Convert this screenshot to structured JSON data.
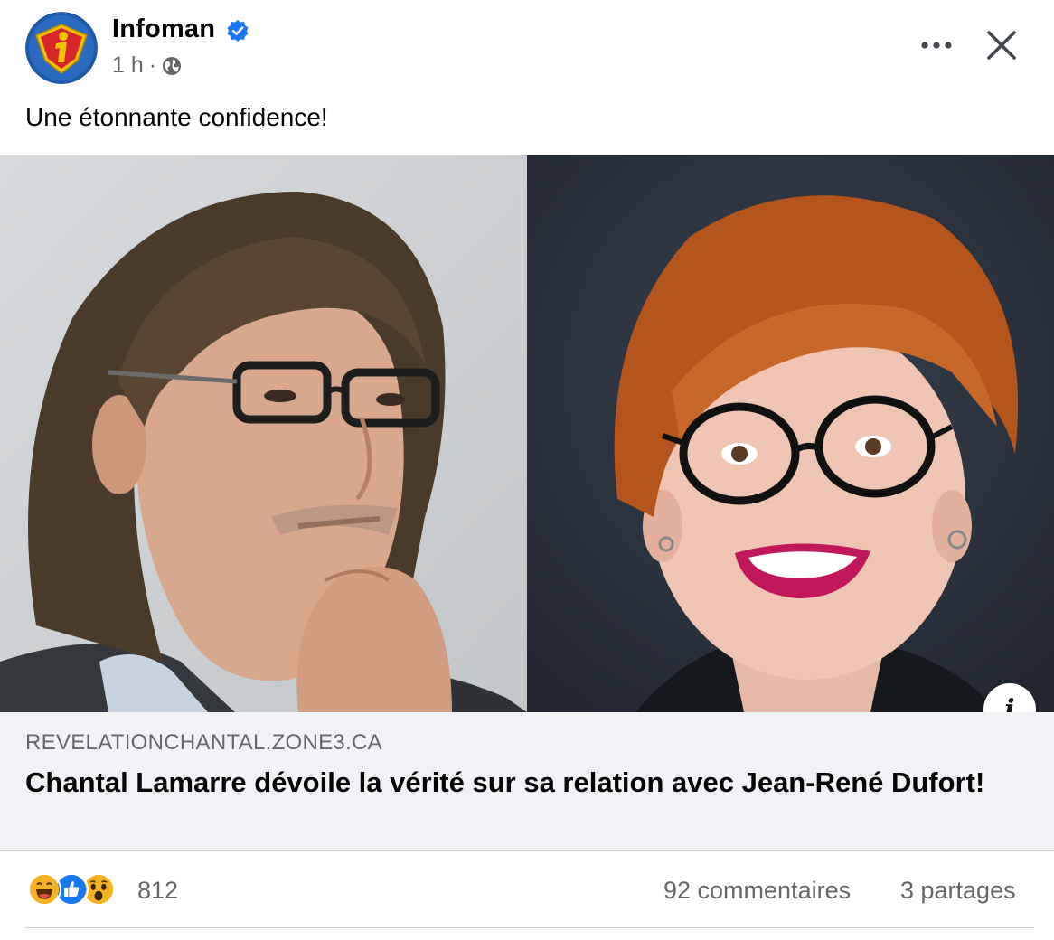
{
  "post": {
    "author": "Infoman",
    "time": "1 h",
    "separator": "·",
    "caption": "Une étonnante confidence!"
  },
  "link_preview": {
    "domain": "REVELATIONCHANTAL.ZONE3.CA",
    "title": "Chantal Lamarre dévoile la vérité sur sa relation avec Jean-René Dufort!"
  },
  "engagement": {
    "reaction_count": "812",
    "comments": "92 commentaires",
    "shares": "3 partages",
    "reaction_icons": [
      "haha-icon",
      "like-icon",
      "wow-icon"
    ]
  },
  "icons": {
    "verified": "verified-badge-icon",
    "privacy": "globe-icon",
    "more": "more-options-icon",
    "close": "close-icon",
    "info": "info-icon"
  },
  "colors": {
    "brand_blue": "#1877f2",
    "secondary_text": "#65676b",
    "link_bg": "#f0f2f5",
    "avatar_red": "#d9262c",
    "avatar_yellow": "#f2c200"
  }
}
